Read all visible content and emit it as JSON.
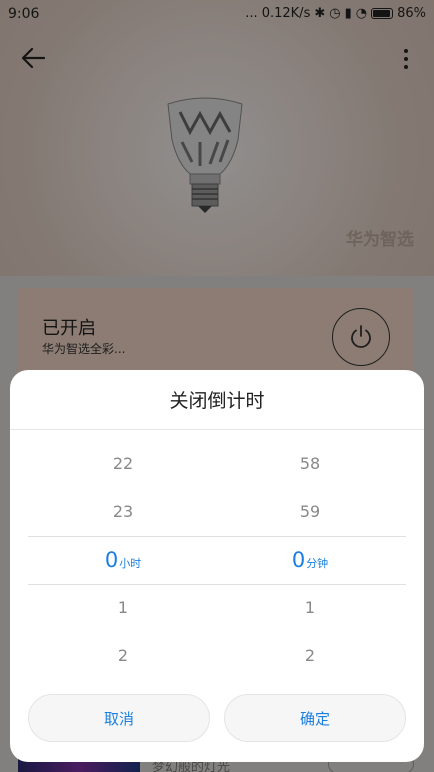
{
  "status": {
    "time": "9:06",
    "right_text": "... 0.12K/s",
    "battery": "86%"
  },
  "header": {
    "brand": "华为智选"
  },
  "device_card": {
    "title": "已开启",
    "subtitle": "华为智选全彩..."
  },
  "below_content": {
    "caption": "梦幻般的灯光"
  },
  "dialog": {
    "title": "关闭倒计时",
    "hours": [
      "22",
      "23",
      "0",
      "1",
      "2"
    ],
    "hours_unit": "小时",
    "minutes": [
      "58",
      "59",
      "0",
      "1",
      "2"
    ],
    "minutes_unit": "分钟",
    "selected_index": 2,
    "cancel_label": "取消",
    "confirm_label": "确定"
  },
  "colors": {
    "accent": "#1a7fe0",
    "card_bg": "#e9cfc0"
  }
}
